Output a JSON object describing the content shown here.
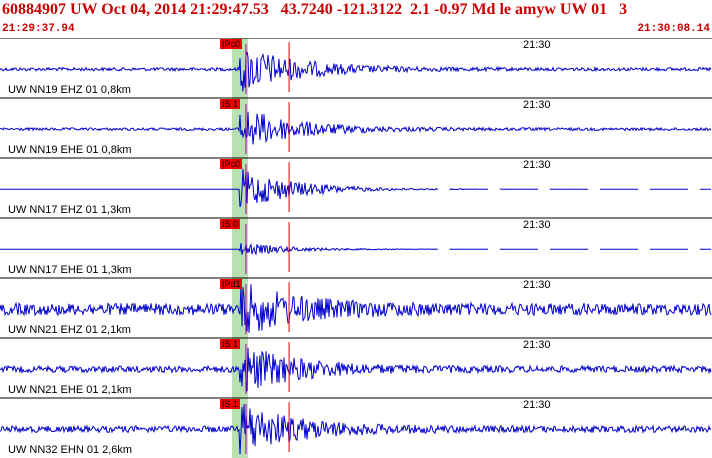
{
  "header": {
    "title": "60884907 UW Oct 04, 2014 21:29:47.53   43.7240 -121.3122  2.1 -0.97 Md le amyw UW 01   3",
    "start_time": "21:29:37.94",
    "end_time": "21:30:08.14"
  },
  "colors": {
    "header_text": "#cc0000",
    "trace": "#0000cc",
    "pick_flag": "#ee0000",
    "pick_window": "#b8e0b0",
    "separator": "#000000"
  },
  "traces": [
    {
      "label": "UW NN19 EHZ 01 0,8km",
      "pick": "IPc0",
      "time_mark": "21:30",
      "pick_pos": 0.337,
      "end_pos": 0.406,
      "amp": 0.9,
      "noise": 0.06,
      "gaps": false
    },
    {
      "label": "UW NN19 EHE 01 0,8km",
      "pick": "IS 1",
      "time_mark": "21:30",
      "pick_pos": 0.337,
      "end_pos": 0.406,
      "amp": 0.8,
      "noise": 0.05,
      "gaps": false
    },
    {
      "label": "UW NN17 EHZ 01 1,3km",
      "pick": "IPc0",
      "time_mark": "21:30",
      "pick_pos": 0.337,
      "end_pos": 0.406,
      "amp": 0.8,
      "noise": 0.0,
      "gaps": true
    },
    {
      "label": "UW NN17 EHE 01 1,3km",
      "pick": "IS 0",
      "time_mark": "21:30",
      "pick_pos": 0.337,
      "end_pos": 0.406,
      "amp": 0.25,
      "noise": 0.0,
      "gaps": true
    },
    {
      "label": "UW NN21 EHZ 01 2,1km",
      "pick": "IPd1",
      "time_mark": "21:30",
      "pick_pos": 0.337,
      "end_pos": 0.406,
      "amp": 0.9,
      "noise": 0.22,
      "gaps": false
    },
    {
      "label": "UW NN21 EHE 01 2,1km",
      "pick": "IS 1",
      "time_mark": "21:30",
      "pick_pos": 0.337,
      "end_pos": 0.406,
      "amp": 0.9,
      "noise": 0.12,
      "gaps": false
    },
    {
      "label": "UW NN32 EHN 01 2,6km",
      "pick": "IS 1",
      "time_mark": "21:30",
      "pick_pos": 0.337,
      "end_pos": 0.406,
      "amp": 0.95,
      "noise": 0.12,
      "gaps": false
    }
  ]
}
